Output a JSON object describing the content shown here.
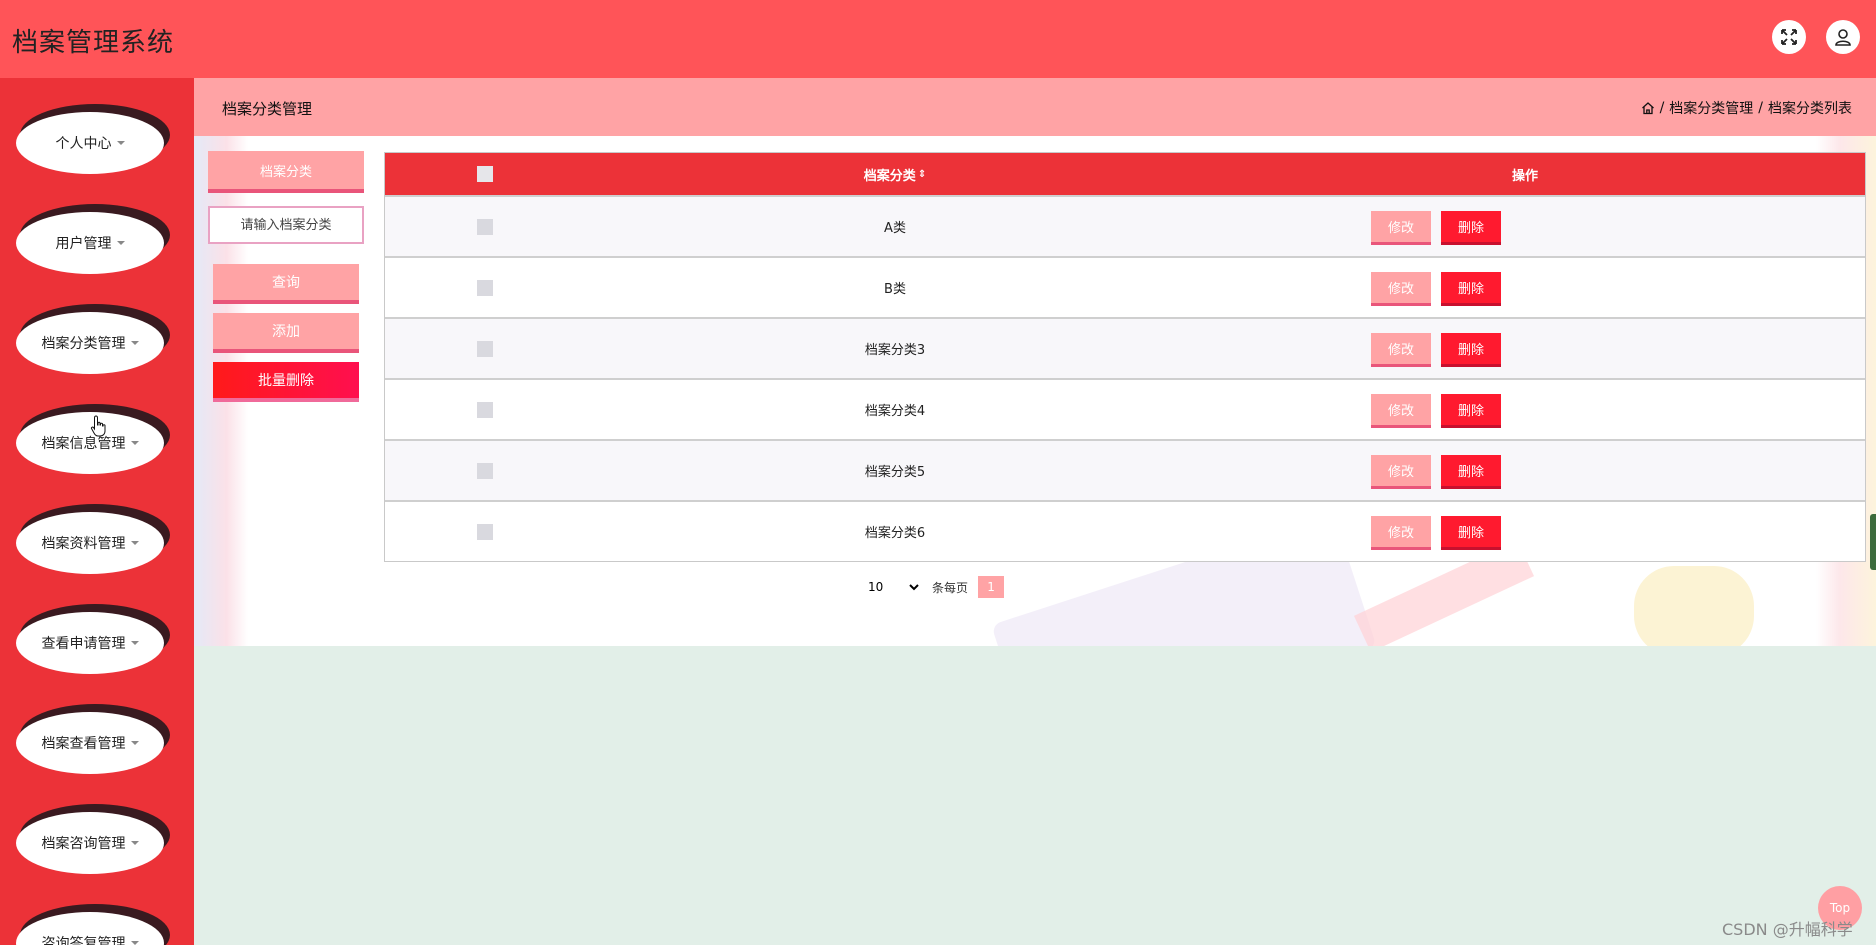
{
  "app": {
    "title": "档案管理系统"
  },
  "header": {
    "icons": {
      "fullscreen": "expand-icon",
      "user": "user-icon"
    }
  },
  "sidebar": {
    "items": [
      {
        "label": "个人中心"
      },
      {
        "label": "用户管理"
      },
      {
        "label": "档案分类管理"
      },
      {
        "label": "档案信息管理"
      },
      {
        "label": "档案资料管理"
      },
      {
        "label": "查看申请管理"
      },
      {
        "label": "档案查看管理"
      },
      {
        "label": "档案咨询管理"
      },
      {
        "label": "咨询答复管理"
      }
    ]
  },
  "page": {
    "title": "档案分类管理",
    "breadcrumb": [
      "档案分类管理",
      "档案分类列表"
    ]
  },
  "search": {
    "field_label": "档案分类",
    "placeholder": "请输入档案分类",
    "query_label": "查询",
    "add_label": "添加",
    "batch_delete_label": "批量删除"
  },
  "table": {
    "columns": {
      "name": "档案分类",
      "sort_glyph": "⇕",
      "operation": "操作"
    },
    "edit_label": "修改",
    "delete_label": "删除",
    "rows": [
      {
        "name": "A类"
      },
      {
        "name": "B类"
      },
      {
        "name": "档案分类3"
      },
      {
        "name": "档案分类4"
      },
      {
        "name": "档案分类5"
      },
      {
        "name": "档案分类6"
      }
    ]
  },
  "pagination": {
    "page_size": "10",
    "page_size_options": [
      "10"
    ],
    "per_page_label": "条每页",
    "current_page": "1"
  },
  "back_to_top": "Top",
  "watermark": "CSDN @升幅科学",
  "colors": {
    "header": "#ff5458",
    "sidebar": "#ec3238",
    "accent_light": "#ffa3a5",
    "danger": "#ff1a2f",
    "content_bg": "#e2efe8"
  }
}
